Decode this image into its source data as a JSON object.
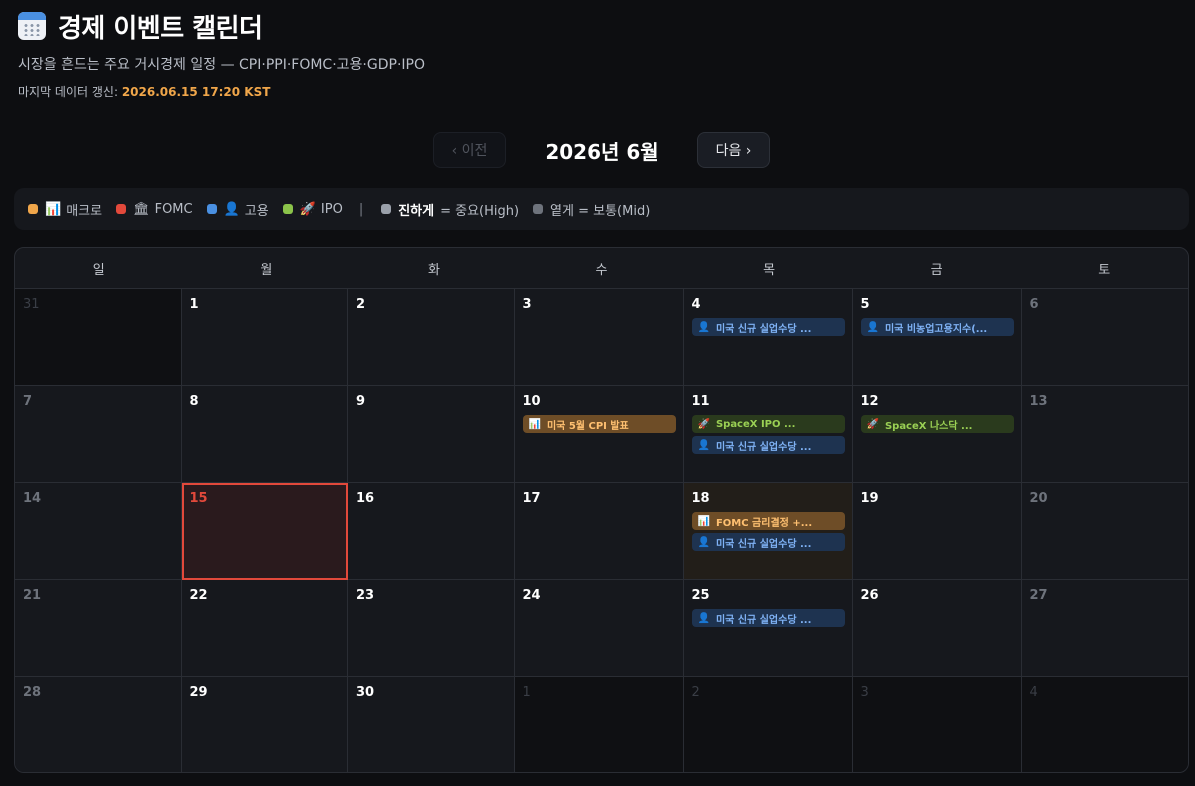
{
  "app": {
    "title": "경제 이벤트 캘린더",
    "subtitle": "시장을 흔드는 주요 거시경제 일정 — CPI·PPI·FOMC·고용·GDP·IPO",
    "updated_label": "마지막 데이터 갱신:",
    "updated_value": "2026.06.15 17:20 KST"
  },
  "nav": {
    "prev_label": "‹ 이전",
    "month_label": "2026년 6월",
    "next_label": "다음 ›"
  },
  "legend": {
    "items": [
      {
        "icon": "📊",
        "label": "매크로",
        "color": "#f0a64a"
      },
      {
        "icon": "🏛",
        "label": "FOMC",
        "color": "#e2493b"
      },
      {
        "icon": "👤",
        "label": "고용",
        "color": "#4a90e2"
      },
      {
        "icon": "🚀",
        "label": "IPO",
        "color": "#8bc34a"
      }
    ],
    "separator": "|",
    "strong_label": "진하게",
    "strong_desc": "= 중요(High)",
    "light_desc": "옅게 = 보통(Mid)"
  },
  "weekdays": [
    "일",
    "월",
    "화",
    "수",
    "목",
    "금",
    "토"
  ],
  "days": [
    {
      "num": "31",
      "type": "other",
      "events": []
    },
    {
      "num": "1",
      "type": "normal",
      "events": []
    },
    {
      "num": "2",
      "type": "normal",
      "events": []
    },
    {
      "num": "3",
      "type": "normal",
      "events": []
    },
    {
      "num": "4",
      "type": "normal",
      "events": [
        {
          "kind": "job",
          "icon": "👤",
          "text": "미국 신규 실업수당 ..."
        }
      ]
    },
    {
      "num": "5",
      "type": "normal",
      "events": [
        {
          "kind": "job",
          "icon": "👤",
          "text": "미국 비농업고용지수(..."
        }
      ]
    },
    {
      "num": "6",
      "type": "weekend",
      "events": []
    },
    {
      "num": "7",
      "type": "weekend",
      "events": []
    },
    {
      "num": "8",
      "type": "normal",
      "events": []
    },
    {
      "num": "9",
      "type": "normal",
      "events": []
    },
    {
      "num": "10",
      "type": "normal",
      "events": [
        {
          "kind": "macro",
          "icon": "📊",
          "text": "미국 5월 CPI 발표"
        }
      ]
    },
    {
      "num": "11",
      "type": "normal",
      "events": [
        {
          "kind": "ipo",
          "icon": "🚀",
          "text": "SpaceX IPO ..."
        },
        {
          "kind": "job",
          "icon": "👤",
          "text": "미국 신규 실업수당 ..."
        }
      ]
    },
    {
      "num": "12",
      "type": "normal",
      "events": [
        {
          "kind": "ipo",
          "icon": "🚀",
          "text": "SpaceX 나스닥 ..."
        }
      ]
    },
    {
      "num": "13",
      "type": "weekend",
      "events": []
    },
    {
      "num": "14",
      "type": "weekend",
      "events": []
    },
    {
      "num": "15",
      "type": "today",
      "events": []
    },
    {
      "num": "16",
      "type": "normal",
      "events": []
    },
    {
      "num": "17",
      "type": "normal",
      "events": []
    },
    {
      "num": "18",
      "type": "highlight",
      "events": [
        {
          "kind": "macro",
          "icon": "📊",
          "text": "FOMC 금리결정 +..."
        },
        {
          "kind": "job",
          "icon": "👤",
          "text": "미국 신규 실업수당 ..."
        }
      ]
    },
    {
      "num": "19",
      "type": "normal",
      "events": []
    },
    {
      "num": "20",
      "type": "weekend",
      "events": []
    },
    {
      "num": "21",
      "type": "weekend",
      "events": []
    },
    {
      "num": "22",
      "type": "normal",
      "events": []
    },
    {
      "num": "23",
      "type": "normal",
      "events": []
    },
    {
      "num": "24",
      "type": "normal",
      "events": []
    },
    {
      "num": "25",
      "type": "normal",
      "events": [
        {
          "kind": "job",
          "icon": "👤",
          "text": "미국 신규 실업수당 ..."
        }
      ]
    },
    {
      "num": "26",
      "type": "normal",
      "events": []
    },
    {
      "num": "27",
      "type": "weekend",
      "events": []
    },
    {
      "num": "28",
      "type": "weekend",
      "events": []
    },
    {
      "num": "29",
      "type": "normal",
      "events": []
    },
    {
      "num": "30",
      "type": "normal",
      "events": []
    },
    {
      "num": "1",
      "type": "other",
      "events": []
    },
    {
      "num": "2",
      "type": "other",
      "events": []
    },
    {
      "num": "3",
      "type": "other",
      "events": []
    },
    {
      "num": "4",
      "type": "other",
      "events": []
    }
  ]
}
